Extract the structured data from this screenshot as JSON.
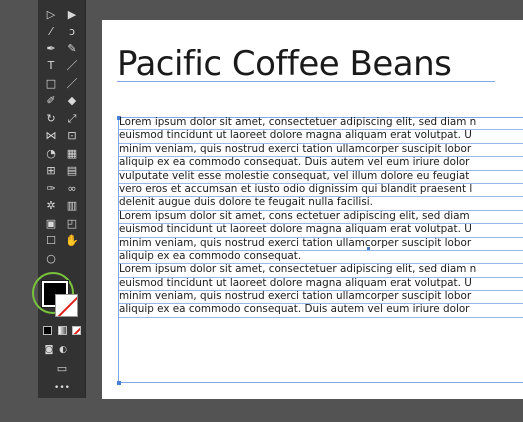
{
  "toolbar": {
    "tools": [
      {
        "name": "selection-tool-icon",
        "glyph": "▷"
      },
      {
        "name": "direct-selection-tool-icon",
        "glyph": "▶"
      },
      {
        "name": "magic-wand-tool-icon",
        "glyph": "⁄"
      },
      {
        "name": "lasso-tool-icon",
        "glyph": "ↄ"
      },
      {
        "name": "pen-tool-icon",
        "glyph": "✒"
      },
      {
        "name": "curvature-tool-icon",
        "glyph": "✎"
      },
      {
        "name": "type-tool-icon",
        "glyph": "T"
      },
      {
        "name": "line-segment-tool-icon",
        "glyph": "／"
      },
      {
        "name": "rectangle-tool-icon",
        "glyph": "□"
      },
      {
        "name": "paintbrush-tool-icon",
        "glyph": "／"
      },
      {
        "name": "shaper-tool-icon",
        "glyph": "✐"
      },
      {
        "name": "eraser-tool-icon",
        "glyph": "◆"
      },
      {
        "name": "rotate-tool-icon",
        "glyph": "↻"
      },
      {
        "name": "scale-tool-icon",
        "glyph": "⤢"
      },
      {
        "name": "width-tool-icon",
        "glyph": "⋈"
      },
      {
        "name": "free-transform-tool-icon",
        "glyph": "⊡"
      },
      {
        "name": "shape-builder-tool-icon",
        "glyph": "◔"
      },
      {
        "name": "perspective-grid-tool-icon",
        "glyph": "▦"
      },
      {
        "name": "mesh-tool-icon",
        "glyph": "⊞"
      },
      {
        "name": "gradient-tool-icon",
        "glyph": "▤"
      },
      {
        "name": "eyedropper-tool-icon",
        "glyph": "✑"
      },
      {
        "name": "blend-tool-icon",
        "glyph": "∞"
      },
      {
        "name": "symbol-sprayer-tool-icon",
        "glyph": "✲"
      },
      {
        "name": "column-graph-tool-icon",
        "glyph": "▥"
      },
      {
        "name": "artboard-tool-icon",
        "glyph": "▣"
      },
      {
        "name": "slice-tool-icon",
        "glyph": "◰"
      },
      {
        "name": "hand-tool-icon",
        "glyph": "☐"
      },
      {
        "name": "hand-grab-tool-icon",
        "glyph": "✋"
      },
      {
        "name": "zoom-tool-icon",
        "glyph": "○"
      }
    ],
    "more_label": "•••"
  },
  "colors": {
    "fill": "#000000",
    "stroke": "none",
    "highlight": "#78c23c",
    "selection": "#7fa6e6"
  },
  "document": {
    "heading": "Pacific Coffee Beans",
    "lines": [
      "Lorem ipsum dolor sit amet, consectetuer adipiscing elit, sed diam n",
      "euismod tincidunt ut laoreet dolore magna aliquam erat volutpat. U",
      "minim veniam, quis nostrud exerci tation ullamcorper suscipit lobor",
      "aliquip ex ea commodo consequat. Duis autem vel eum iriure dolor",
      "vulputate velit esse molestie consequat, vel illum dolore eu feugiat",
      "vero eros et accumsan et iusto odio dignissim qui blandit praesent l",
      "delenit augue duis dolore te feugait nulla facilisi.",
      "Lorem ipsum dolor sit amet, cons ectetuer adipiscing elit, sed diam",
      "euismod tincidunt ut laoreet dolore magna aliquam erat volutpat. U",
      "minim veniam, quis nostrud exerci tation ullamcorper suscipit lobor",
      "aliquip ex ea commodo consequat.",
      "Lorem ipsum dolor sit amet, consectetuer adipiscing elit, sed diam n",
      "euismod tincidunt ut laoreet dolore magna aliquam erat volutpat. U",
      "minim veniam, quis nostrud exerci tation ullamcorper suscipit lobor",
      "aliquip ex ea commodo consequat. Duis autem vel eum iriure dolor"
    ]
  }
}
